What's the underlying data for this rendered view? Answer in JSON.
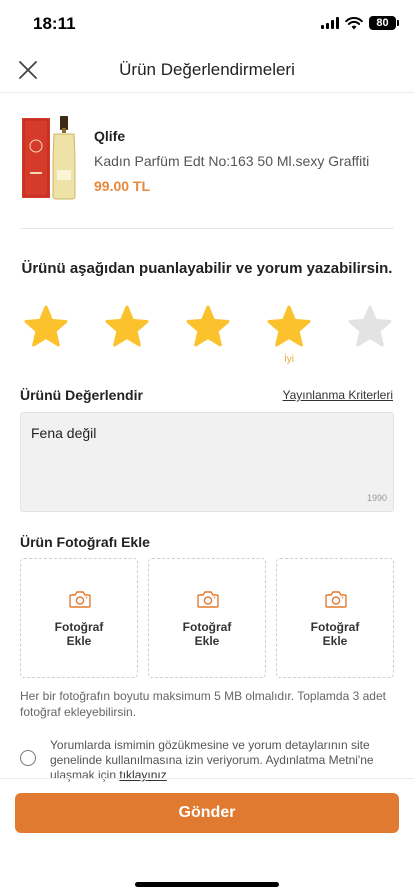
{
  "status_bar": {
    "time": "18:11",
    "battery": "80"
  },
  "header": {
    "title": "Ürün Değerlendirmeleri",
    "close_icon": "close-icon"
  },
  "product": {
    "brand": "Qlife",
    "name": "Kadın Parfüm Edt No:163 50 Ml.sexy Graffiti",
    "price": "99.00 TL",
    "image_icon": "perfume-bottle-image"
  },
  "rating": {
    "prompt": "Ürünü aşağıdan puanlayabilir ve yorum yazabilirsin.",
    "max": 5,
    "value": 4,
    "selected_label": "İyi",
    "colors": {
      "filled": "#fcc22d",
      "empty": "#e3e3e3",
      "caption": "#e8a83a"
    }
  },
  "review": {
    "label": "Ürünü Değerlendir",
    "criteria_link": "Yayınlanma Kriterleri",
    "text": "Fena değil",
    "remaining_chars": "1990"
  },
  "photos": {
    "label": "Ürün Fotoğrafı Ekle",
    "slots": [
      {
        "line1": "Fotoğraf",
        "line2": "Ekle"
      },
      {
        "line1": "Fotoğraf",
        "line2": "Ekle"
      },
      {
        "line1": "Fotoğraf",
        "line2": "Ekle"
      }
    ],
    "note": "Her bir fotoğrafın boyutu maksimum 5 MB olmalıdır. Toplamda 3 adet fotoğraf ekleyebilirsin.",
    "icon": "camera-icon",
    "icon_color": "#e07a30"
  },
  "consent": {
    "text": "Yorumlarda ismimin gözükmesine ve yorum detaylarının site genelinde kullanılmasına izin veriyorum. Aydınlatma Metni'ne ulaşmak için",
    "link": "tıklayınız",
    "checked": false
  },
  "submit": {
    "label": "Gönder",
    "color": "#e07a30"
  }
}
